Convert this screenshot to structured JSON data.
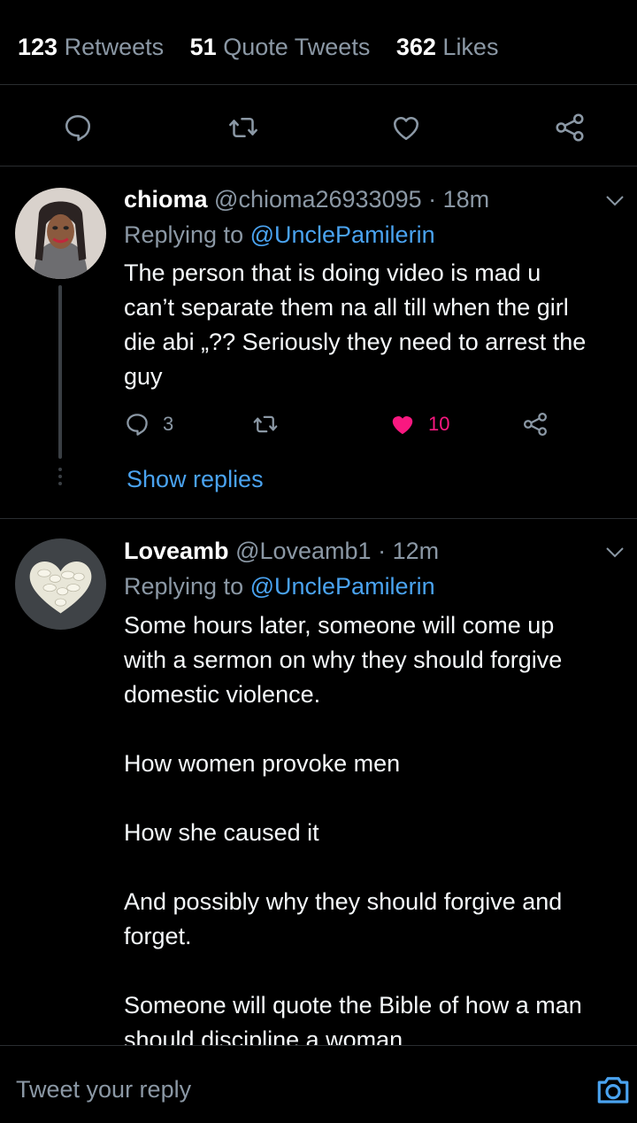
{
  "stats": [
    {
      "count": "123",
      "label": "Retweets"
    },
    {
      "count": "51",
      "label": "Quote Tweets"
    },
    {
      "count": "362",
      "label": "Likes"
    }
  ],
  "actions": {
    "icons": [
      "reply-icon",
      "retweet-icon",
      "like-icon",
      "share-icon"
    ],
    "color": "#8b98a5"
  },
  "tweets": [
    {
      "name": "chioma",
      "handle": "@chioma26933095",
      "time": "· 18m",
      "replying_prefix": "Replying to",
      "replying_to": "@UnclePamilerin",
      "text": "The person that is doing video is mad u\ncan’t separate them na all till when the girl\ndie abi „?? Seriously they need to arrest the\nguy",
      "reply_count": "3",
      "retweet_count": "",
      "like_count": "10",
      "liked": true,
      "show_replies": "Show replies"
    },
    {
      "name": "Loveamb",
      "handle": "@Loveamb1",
      "time": "· 12m",
      "replying_prefix": "Replying to",
      "replying_to": "@UnclePamilerin",
      "text": "Some hours later, someone will come up\nwith a sermon on why they should forgive\ndomestic violence.\n\nHow women provoke men\n\nHow she caused it\n\nAnd possibly why they should forgive and\nforget.\n\nSomeone will quote the Bible of how a man\nshould discipline a woman"
    }
  ],
  "reply_bar": {
    "placeholder": "Tweet your reply"
  },
  "colors": {
    "background": "#000000",
    "muted": "#8b98a5",
    "link": "#4aa3f0",
    "like": "#f91880"
  }
}
